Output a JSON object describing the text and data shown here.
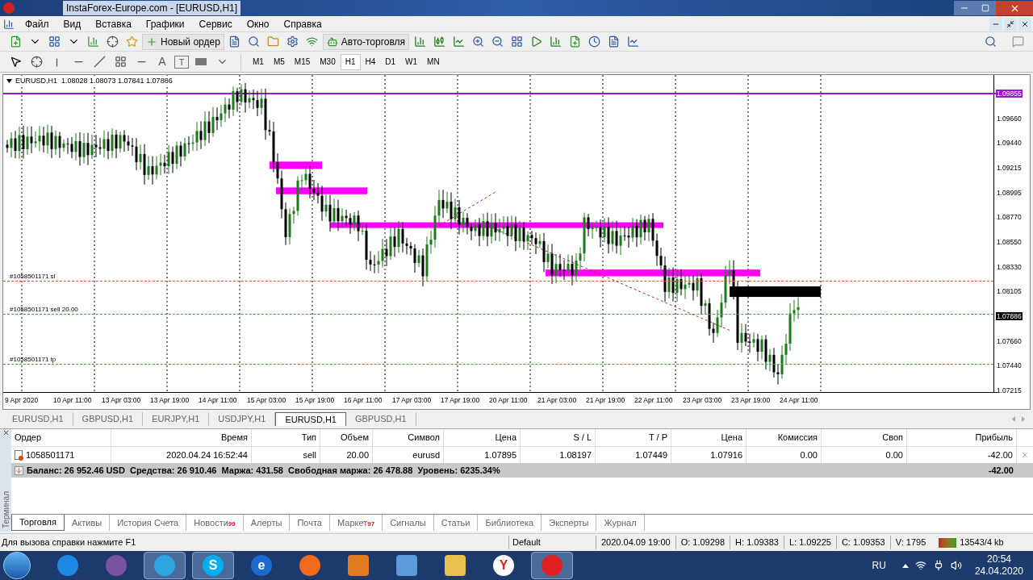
{
  "window": {
    "title": "InstaForex-Europe.com - [EURUSD,H1]"
  },
  "menu": [
    "Файл",
    "Вид",
    "Вставка",
    "Графики",
    "Сервис",
    "Окно",
    "Справка"
  ],
  "toolbar": {
    "new_order": "Новый ордер",
    "auto_trading": "Авто-торговля",
    "text_tool": "A",
    "label_tool": "T"
  },
  "timeframes": [
    {
      "label": "M1",
      "selected": false
    },
    {
      "label": "M5",
      "selected": false
    },
    {
      "label": "M15",
      "selected": false
    },
    {
      "label": "M30",
      "selected": false
    },
    {
      "label": "H1",
      "selected": true
    },
    {
      "label": "H4",
      "selected": false
    },
    {
      "label": "D1",
      "selected": false
    },
    {
      "label": "W1",
      "selected": false
    },
    {
      "label": "MN",
      "selected": false
    }
  ],
  "chart": {
    "header": "EURUSD,H1  1.08028 1.08073 1.07841 1.07886",
    "order_lines": [
      {
        "label": "#1058501171 sl",
        "color": "#c8602a"
      },
      {
        "label": "#1058501171 sell 20.00",
        "color": "#4a9a4a"
      },
      {
        "label": "#1058501171 tp",
        "color": "#c8602a"
      }
    ],
    "price_axis": [
      {
        "label": "1.09855",
        "kind": "marker",
        "color": "#9b19c9"
      },
      {
        "label": "1.09660",
        "kind": "tick"
      },
      {
        "label": "1.09440",
        "kind": "tick"
      },
      {
        "label": "1.09215",
        "kind": "tick"
      },
      {
        "label": "1.08995",
        "kind": "tick"
      },
      {
        "label": "1.08770",
        "kind": "tick"
      },
      {
        "label": "1.08550",
        "kind": "tick"
      },
      {
        "label": "1.08330",
        "kind": "tick"
      },
      {
        "label": "1.08105",
        "kind": "tick"
      },
      {
        "label": "1.07886",
        "kind": "marker",
        "color": "#000000"
      },
      {
        "label": "1.07660",
        "kind": "tick"
      },
      {
        "label": "1.07440",
        "kind": "tick"
      },
      {
        "label": "1.07215",
        "kind": "tick"
      }
    ],
    "time_axis": [
      "9 Apr 2020",
      "10 Apr 11:00",
      "13 Apr 03:00",
      "13 Apr 19:00",
      "14 Apr 11:00",
      "15 Apr 03:00",
      "15 Apr 19:00",
      "16 Apr 11:00",
      "17 Apr 03:00",
      "17 Apr 19:00",
      "20 Apr 11:00",
      "21 Apr 03:00",
      "21 Apr 19:00",
      "22 Apr 11:00",
      "23 Apr 03:00",
      "23 Apr 19:00",
      "24 Apr 11:00"
    ]
  },
  "chart_tabs": [
    {
      "label": "EURUSD,H1",
      "selected": false
    },
    {
      "label": "GBPUSD,H1",
      "selected": false
    },
    {
      "label": "EURJPY,H1",
      "selected": false
    },
    {
      "label": "USDJPY,H1",
      "selected": false
    },
    {
      "label": "EURUSD,H1",
      "selected": true
    },
    {
      "label": "GBPUSD,H1",
      "selected": false
    }
  ],
  "terminal": {
    "side_label": "Терминал",
    "columns": [
      "Ордер",
      "Время",
      "Тип",
      "Объем",
      "Символ",
      "Цена",
      "S / L",
      "T / P",
      "Цена",
      "Комиссия",
      "Своп",
      "Прибыль"
    ],
    "rows": [
      [
        "1058501171",
        "2020.04.24 16:52:44",
        "sell",
        "20.00",
        "eurusd",
        "1.07895",
        "1.08197",
        "1.07449",
        "1.07916",
        "0.00",
        "0.00",
        "-42.00"
      ]
    ],
    "summary": "Баланс: 26 952.46 USD  Средства: 26 910.46  Маржа: 431.58  Свободная маржа: 26 478.88  Уровень: 6235.34%",
    "summary_profit": "-42.00",
    "tabs": [
      {
        "label": "Торговля",
        "selected": true
      },
      {
        "label": "Активы",
        "selected": false
      },
      {
        "label": "История Счета",
        "selected": false
      },
      {
        "label": "Новости",
        "badge": "99",
        "selected": false
      },
      {
        "label": "Алерты",
        "selected": false
      },
      {
        "label": "Почта",
        "selected": false
      },
      {
        "label": "Маркет",
        "badge": "97",
        "selected": false
      },
      {
        "label": "Сигналы",
        "selected": false
      },
      {
        "label": "Статьи",
        "selected": false
      },
      {
        "label": "Библиотека",
        "selected": false
      },
      {
        "label": "Эксперты",
        "selected": false
      },
      {
        "label": "Журнал",
        "selected": false
      }
    ]
  },
  "status_bar": {
    "help": "Для вызова справки нажмите F1",
    "profile": "Default",
    "fields": [
      "2020.04.09 19:00",
      "O: 1.09298",
      "H: 1.09383",
      "L: 1.09225",
      "C: 1.09353",
      "V: 1795"
    ],
    "traffic": "13543/4 kb"
  },
  "taskbar": {
    "apps": [
      {
        "kind": "remote",
        "active": false
      },
      {
        "kind": "viber",
        "active": false
      },
      {
        "kind": "telegram",
        "active": true
      },
      {
        "kind": "skype",
        "letter": "S",
        "active": true
      },
      {
        "kind": "browser",
        "letter": "e",
        "active": false
      },
      {
        "kind": "firefox",
        "active": false
      },
      {
        "kind": "player",
        "active": false
      },
      {
        "kind": "speaker",
        "active": false
      },
      {
        "kind": "folder",
        "active": false
      },
      {
        "kind": "yandex",
        "letter": "Y",
        "active": false
      },
      {
        "kind": "gear",
        "active": true
      }
    ],
    "language": "RU",
    "time": "20:54",
    "date": "24.04.2020"
  }
}
